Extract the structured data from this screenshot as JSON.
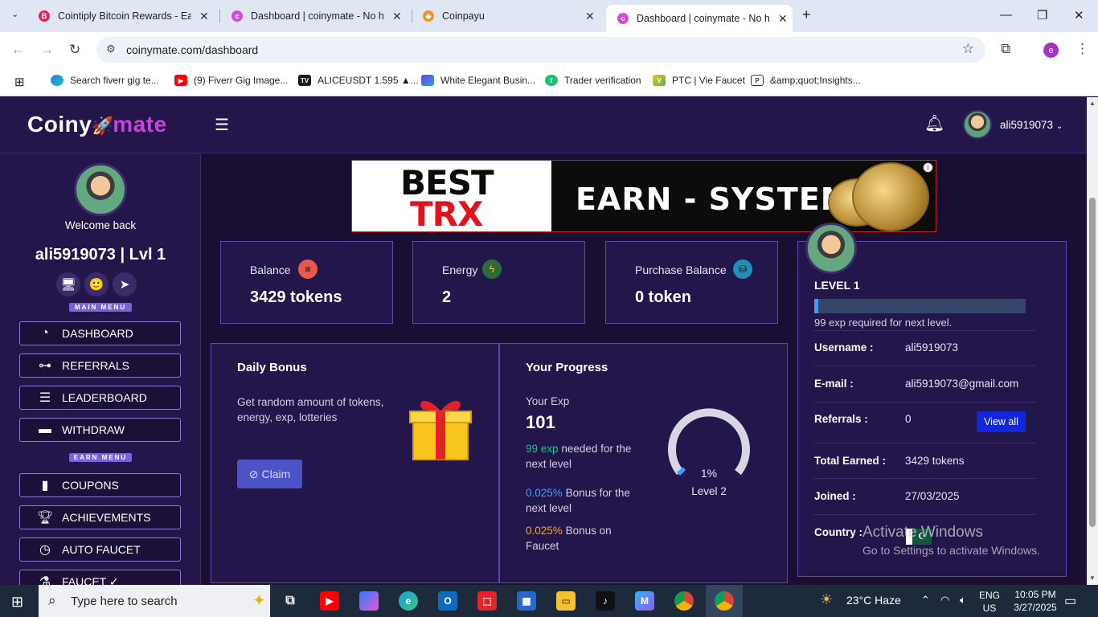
{
  "browser": {
    "tabs": [
      {
        "title": "Cointiply Bitcoin Rewards - Earn",
        "icon": "cointiply-favicon",
        "color": "#e0245e"
      },
      {
        "title": "Dashboard | coinymate - No ha",
        "icon": "coinymate-favicon",
        "color": "#d24bd8"
      },
      {
        "title": "Coinpayu",
        "icon": "coinpayu-favicon",
        "color": "#f39324"
      },
      {
        "title": "Dashboard | coinymate - No ha",
        "icon": "coinymate-favicon",
        "color": "#d24bd8",
        "active": true
      }
    ],
    "url": "coinymate.com/dashboard",
    "profile_initial": "e",
    "bookmarks": [
      {
        "label": "Search fiverr gig te...",
        "icon": "copilot-icon"
      },
      {
        "label": "(9) Fiverr Gig Image...",
        "icon": "youtube-icon"
      },
      {
        "label": "ALICEUSDT 1.595 ▲...",
        "icon": "tradingview-icon"
      },
      {
        "label": "White Elegant Busin...",
        "icon": "canva-icon"
      },
      {
        "label": "Trader verification",
        "icon": "fiverr-icon"
      },
      {
        "label": "PTC | Vie Faucet",
        "icon": "viefaucet-icon"
      },
      {
        "label": "&amp;quot;Insights...",
        "icon": "document-icon"
      }
    ]
  },
  "header": {
    "logo_left": "Coiny",
    "logo_right": "mate",
    "username": "ali5919073"
  },
  "sidebar": {
    "welcome": "Welcome back",
    "user_level": "ali5919073 | Lvl 1",
    "main_menu_label": "MAIN MENU",
    "earn_menu_label": "EARN MENU",
    "main_items": [
      {
        "label": "DASHBOARD",
        "icon": "gauge-icon"
      },
      {
        "label": "REFERRALS",
        "icon": "network-icon"
      },
      {
        "label": "LEADERBOARD",
        "icon": "list-ordered-icon"
      },
      {
        "label": "WITHDRAW",
        "icon": "wallet-icon"
      }
    ],
    "earn_items": [
      {
        "label": "COUPONS",
        "icon": "file-icon"
      },
      {
        "label": "ACHIEVEMENTS",
        "icon": "trophy-icon"
      },
      {
        "label": "AUTO FAUCET",
        "icon": "clock-icon"
      },
      {
        "label": "FAUCET ✓",
        "icon": "faucet-icon"
      }
    ]
  },
  "ad": {
    "line1": "BEST",
    "line2": "TRX",
    "headline": "EARN - SYSTEM",
    "info": "i"
  },
  "stats": [
    {
      "label": "Balance",
      "value": "3429 tokens",
      "icon": "wallet-coin-icon"
    },
    {
      "label": "Energy",
      "value": "2",
      "icon": "energy-icon"
    },
    {
      "label": "Purchase Balance",
      "value": "0 token",
      "icon": "basket-icon"
    }
  ],
  "daily_bonus": {
    "title": "Daily Bonus",
    "description": "Get random amount of tokens, energy, exp, lotteries",
    "claim_label": "Claim"
  },
  "progress": {
    "title": "Your Progress",
    "exp_label": "Your Exp",
    "exp_value": "101",
    "needed_highlight": "99 exp",
    "needed_rest": "needed for the next level",
    "bonus1_highlight": "0.025%",
    "bonus1_rest": "Bonus for the next level",
    "bonus2_highlight": "0.025%",
    "bonus2_rest": "Bonus on Faucet",
    "gauge_percent": "1%",
    "gauge_fraction": 0.01,
    "gauge_level": "Level 2",
    "colors": {
      "green": "#27c08a",
      "blue": "#3aa0ff",
      "orange": "#f0a53c"
    }
  },
  "profile": {
    "level": "LEVEL 1",
    "progress_fraction": 0.01,
    "exp_required": "99 exp required for next level.",
    "rows": [
      {
        "key": "Username :",
        "value": "ali5919073"
      },
      {
        "key": "E-mail :",
        "value": "ali5919073@gmail.com"
      },
      {
        "key": "Referrals :",
        "value": "0"
      },
      {
        "key": "Total Earned :",
        "value": "3429 tokens"
      },
      {
        "key": "Joined :",
        "value": "27/03/2025"
      },
      {
        "key": "Country :",
        "value": ""
      }
    ],
    "view_all": "View all"
  },
  "watermark": {
    "line1": "Activate Windows",
    "line2": "Go to Settings to activate Windows."
  },
  "taskbar": {
    "search_placeholder": "Type here to search",
    "weather": "23°C  Haze",
    "lang1": "ENG",
    "lang2": "US",
    "time": "10:05 PM",
    "date": "3/27/2025"
  }
}
